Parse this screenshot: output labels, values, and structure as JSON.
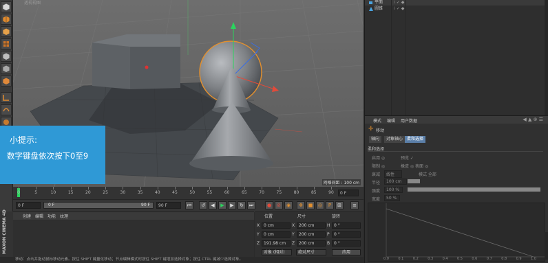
{
  "viewport": {
    "label": "透视视图",
    "grid_scale": "网格间距 : 100 cm"
  },
  "tip": {
    "title": "小提示:",
    "text": "数字键盘依次按下0至9"
  },
  "timeline": {
    "ticks": [
      "0",
      "5",
      "10",
      "15",
      "20",
      "25",
      "30",
      "35",
      "40",
      "45",
      "50",
      "55",
      "60",
      "65",
      "70",
      "75",
      "80",
      "85",
      "90"
    ],
    "end_frame": "0 F"
  },
  "playback": {
    "current": "0 F",
    "range_start": "0 F",
    "range_end": "90 F",
    "max": "90 F"
  },
  "material_manager": {
    "menu": [
      "创建",
      "编辑",
      "功能",
      "纹理"
    ]
  },
  "branding": "MAXON CINEMA 4D",
  "coordinates": {
    "headers": {
      "position": "位置",
      "size": "尺寸",
      "rotation": "旋转"
    },
    "rows": [
      {
        "axis": "X",
        "pos": "0 cm",
        "size": "200 cm",
        "rot_axis": "H",
        "rot": "0 °"
      },
      {
        "axis": "Y",
        "pos": "0 cm",
        "size": "200 cm",
        "rot_axis": "P",
        "rot": "0 °"
      },
      {
        "axis": "Z",
        "pos": "191.98 cm",
        "size": "200 cm",
        "rot_axis": "B",
        "rot": "0 °"
      }
    ],
    "mode_left": "对象 (相对)",
    "mode_mid": "绝对尺寸",
    "apply": "应用"
  },
  "status": "移动：点击并拖动鼠标移动元素。按住 SHIFT 键量化移动；节点编辑模式时按住 SHIFT 键增加选择对象；按住 CTRL 键减少选择对象。",
  "objects": [
    {
      "name": "平面",
      "color": "#4aa3df"
    },
    {
      "name": "圆锥",
      "color": "#4aa3df"
    }
  ],
  "attributes": {
    "menu": [
      "模式",
      "编辑",
      "用户数据"
    ],
    "tool_name": "移动",
    "tabs": [
      "轴向",
      "对象轴心",
      "柔和选择"
    ],
    "section": "柔和选择",
    "rows": [
      {
        "label": "启用 ◎",
        "extra": "预览 ✓"
      },
      {
        "label": "限制 ◎",
        "extra": "橡皮 ◎   表面 ◎"
      },
      {
        "label": "衰减",
        "value": "线性",
        "extra": "模式 全部"
      },
      {
        "label": "半径",
        "value": "100 cm"
      },
      {
        "label": "强度",
        "value": "100 %"
      },
      {
        "label": "宽度",
        "value": "50 %"
      }
    ]
  },
  "graph": {
    "x_ticks": [
      "0.0",
      "0.1",
      "0.2",
      "0.3",
      "0.4",
      "0.5",
      "0.6",
      "0.7",
      "0.8",
      "0.9",
      "1.0"
    ]
  },
  "colors": {
    "tip_bg": "#2f99d6",
    "accent_orange": "#e3902e",
    "timeline_marker": "#2bd45e"
  }
}
